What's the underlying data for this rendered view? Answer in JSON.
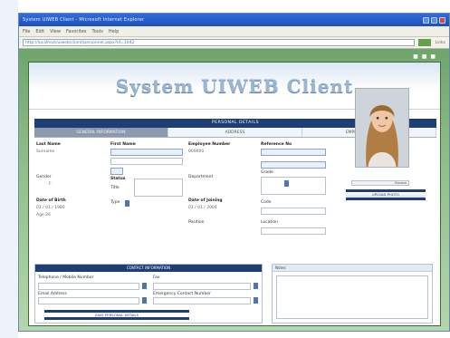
{
  "browser": {
    "title": "System UIWEB Client - Microsoft Internet Explorer",
    "menu": [
      "File",
      "Edit",
      "View",
      "Favorites",
      "Tools",
      "Help"
    ],
    "address": "http://localhost/uiweb/client/personnel.aspx?id=1042",
    "toolbar_right": "Links"
  },
  "page": {
    "banner_title": "System UIWEB Client",
    "top_icons": "■ ■ ■"
  },
  "panel": {
    "header": "PERSONAL DETAILS",
    "tabs": [
      "GENERAL INFORMATION",
      "ADDRESS",
      "EMPLOYMENT RECORD"
    ],
    "col1": {
      "label1": "Last Name",
      "value1": "Surname",
      "label2": "Gender",
      "value2": "F",
      "label3": "Date of Birth",
      "value3": "01 / 01 / 1980",
      "value4": "Age 26"
    },
    "col2": {
      "label1": "First Name",
      "label2": "Status",
      "label3": "Title",
      "label4": "Type"
    },
    "col3": {
      "label1": "Employee Number",
      "value1": "000000",
      "label2": "Department",
      "label3": "Date of Joining",
      "value3": "01 / 01 / 2004",
      "label4": "Position"
    },
    "col4": {
      "label1": "Reference No",
      "label2": "Grade",
      "label3": "Code",
      "label4": "Location"
    },
    "photo_btn1": "Browse",
    "photo_btn2": "UPLOAD PHOTO"
  },
  "bottom_left": {
    "header": "CONTACT INFORMATION",
    "label1": "Telephone / Mobile Number",
    "label2": "Email Address",
    "label3": "Fax",
    "label4": "Emergency Contact Number",
    "button": "SAVE PERSONAL DETAILS"
  },
  "bottom_right": {
    "header": "Notes"
  }
}
